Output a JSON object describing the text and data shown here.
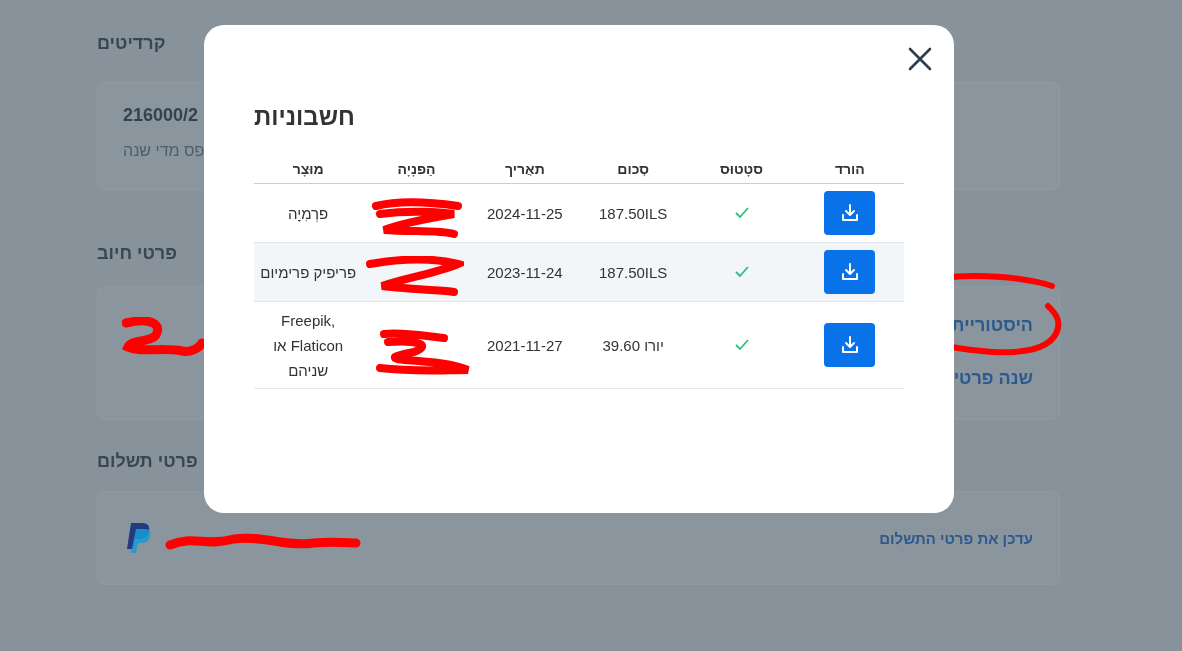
{
  "credits": {
    "title": "קרדיטים",
    "value": "216000/2",
    "note": "פס מדי שנה"
  },
  "billing": {
    "title": "פרטי חיוב",
    "links": [
      "היסטוריית",
      "שנה פרטי"
    ]
  },
  "payment": {
    "title": "פרטי תשלום",
    "link": "עדכן את פרטי התשלום"
  },
  "modal": {
    "title": "חשבוניות",
    "columns": [
      "הורד",
      "סטָטוּס",
      "סְכום",
      "תאֲריך",
      "הַפנָיָה",
      "מוּצָר"
    ],
    "rows": [
      {
        "paid": true,
        "amount": "187.50ILS",
        "date": "2024-11-25",
        "product": "פרְמִיָה"
      },
      {
        "paid": true,
        "amount": "187.50ILS",
        "date": "2023-11-24",
        "product": "פריפיק פרימיום"
      },
      {
        "paid": true,
        "amount": "יורו 39.60",
        "date": "2021-11-27",
        "product": "Freepik, Flaticon או שניהם"
      }
    ]
  }
}
